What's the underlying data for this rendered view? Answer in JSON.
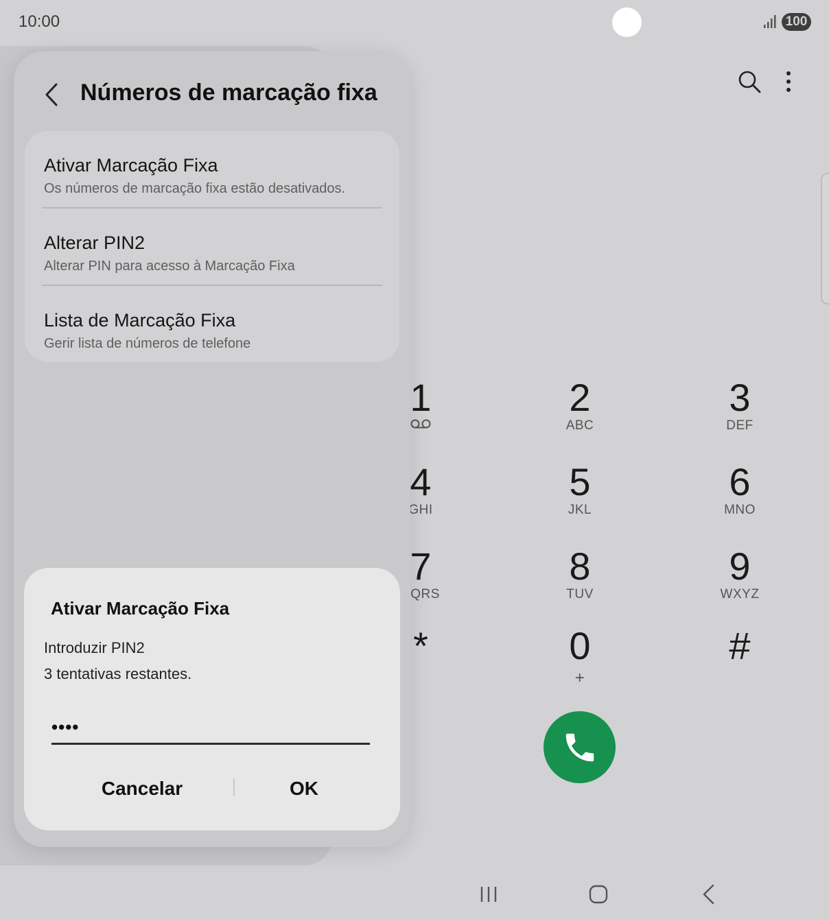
{
  "status_bar": {
    "time": "10:00",
    "battery": "100",
    "signal_icon": "signal-bars-icon"
  },
  "dialer": {
    "top_actions": [
      "search-icon",
      "more-vertical-icon"
    ],
    "keys": [
      {
        "digit": "1",
        "letters": ""
      },
      {
        "digit": "2",
        "letters": "ABC"
      },
      {
        "digit": "3",
        "letters": "DEF"
      },
      {
        "digit": "4",
        "letters": "GHI"
      },
      {
        "digit": "5",
        "letters": "JKL"
      },
      {
        "digit": "6",
        "letters": "MNO"
      },
      {
        "digit": "7",
        "letters": "PQRS"
      },
      {
        "digit": "8",
        "letters": "TUV"
      },
      {
        "digit": "9",
        "letters": "WXYZ"
      },
      {
        "digit": "*",
        "letters": ""
      },
      {
        "digit": "0",
        "letters": "+"
      },
      {
        "digit": "#",
        "letters": ""
      }
    ],
    "call_color": "#16914f"
  },
  "settings": {
    "title": "Números de marcação fixa",
    "items": [
      {
        "title": "Ativar Marcação Fixa",
        "subtitle": "Os números de marcação fixa estão desativados."
      },
      {
        "title": "Alterar PIN2",
        "subtitle": "Alterar PIN para acesso à Marcação Fixa"
      },
      {
        "title": "Lista de Marcação Fixa",
        "subtitle": "Gerir lista de números de telefone"
      }
    ]
  },
  "dialog": {
    "title": "Ativar Marcação Fixa",
    "prompt": "Introduzir PIN2",
    "attempts": "3 tentativas restantes.",
    "pin_value": "••••",
    "cancel_label": "Cancelar",
    "ok_label": "OK"
  },
  "navigation": [
    "recents-icon",
    "home-icon",
    "back-icon"
  ]
}
